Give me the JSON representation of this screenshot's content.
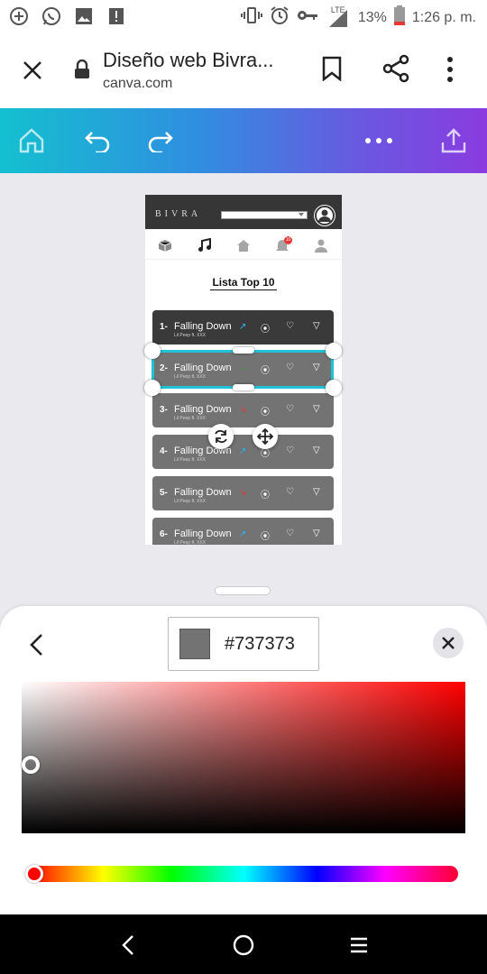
{
  "status_bar": {
    "battery_percent": "13%",
    "time": "1:26 p. m.",
    "network": "LTE",
    "icons": [
      "add-circle-icon",
      "whatsapp-icon",
      "gallery-icon",
      "alert-icon",
      "vibrate-icon",
      "alarm-icon",
      "key-icon",
      "signal-icon",
      "battery-icon"
    ]
  },
  "browser": {
    "title": "Diseño web Bivra...",
    "url": "canva.com",
    "icons": [
      "close-icon",
      "lock-icon",
      "bookmark-icon",
      "share-icon",
      "more-vert-icon"
    ]
  },
  "toolbar": {
    "icons": [
      "home-icon",
      "undo-icon",
      "redo-icon",
      "more-horiz-icon",
      "upload-icon"
    ],
    "gradient": [
      "#14c0cf",
      "#8a3be0"
    ]
  },
  "design": {
    "brand": "BIVRA",
    "nav_badge": "10",
    "list_title": "Lista Top 10",
    "songs": [
      {
        "rank": "1-",
        "title": "Falling Down",
        "artist": "Lil Peep ft. XXX",
        "arrow": "↗",
        "arrow_color": "#29b6f6",
        "plays": "⦿",
        "likes": "♡",
        "filter": "▽"
      },
      {
        "rank": "2-",
        "title": "Falling Down",
        "artist": "Lil Peep ft. XXX",
        "arrow": "→",
        "arrow_color": "#43a047",
        "plays": "⦿",
        "likes": "♡",
        "filter": "▽"
      },
      {
        "rank": "3-",
        "title": "Falling Down",
        "artist": "Lil Peep ft. XXX",
        "arrow": "↘",
        "arrow_color": "#e53935",
        "plays": "⦿",
        "likes": "♡",
        "filter": "▽"
      },
      {
        "rank": "4-",
        "title": "Falling Down",
        "artist": "Lil Peep ft. XXX",
        "arrow": "↗",
        "arrow_color": "#29b6f6",
        "plays": "⦿",
        "likes": "♡",
        "filter": "▽"
      },
      {
        "rank": "5-",
        "title": "Falling Down",
        "artist": "Lil Peep ft. XXX",
        "arrow": "↘",
        "arrow_color": "#e53935",
        "plays": "⦿",
        "likes": "♡",
        "filter": "▽"
      },
      {
        "rank": "6-",
        "title": "Falling Down",
        "artist": "Lil Peep ft. XXX",
        "arrow": "↗",
        "arrow_color": "#29b6f6",
        "plays": "⦿",
        "likes": "♡",
        "filter": "▽"
      }
    ]
  },
  "color_picker": {
    "hex": "#737373",
    "swatch_color": "#737373",
    "hue_color": "#ff0000",
    "saturation": 0.02,
    "brightness": 0.45,
    "hue": 0
  },
  "system_nav": {
    "icons": [
      "back-icon",
      "home-circle-icon",
      "recents-icon"
    ]
  }
}
